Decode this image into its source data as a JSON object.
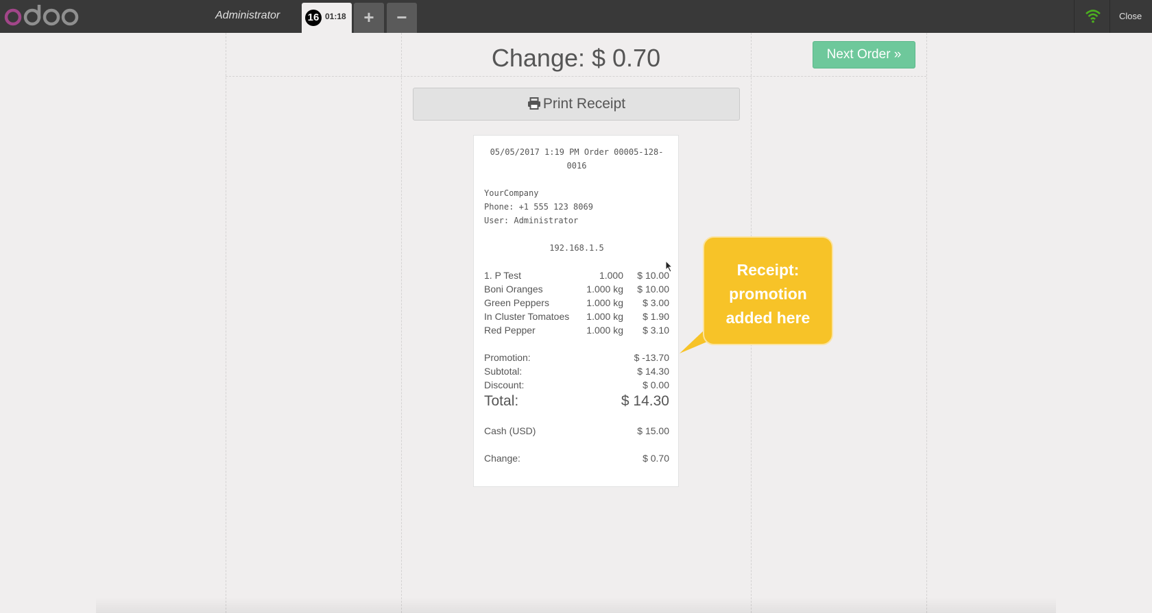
{
  "topbar": {
    "cashier": "Administrator",
    "order_tab": {
      "sequence": "16",
      "time": "01:18"
    },
    "add_order_icon": "plus-icon",
    "remove_order_icon": "minus-icon",
    "connection_icon": "wifi-icon",
    "connection_color": "#4caf1f",
    "close_label": "Close"
  },
  "screen": {
    "change_title": "Change: $ 0.70",
    "next_order_label": "Next Order »",
    "print_receipt_label": "Print Receipt",
    "print_icon": "printer-icon"
  },
  "receipt": {
    "header_line1": "05/05/2017 1:19 PM Order 00005-128-",
    "header_line2": "0016",
    "company": "YourCompany",
    "phone": "Phone: +1 555 123 8069",
    "user": "User: Administrator",
    "ip": "192.168.1.5",
    "lines": [
      {
        "name": "1. P Test",
        "qty": "1.000",
        "price": "$ 10.00"
      },
      {
        "name": "Boni Oranges",
        "qty": "1.000 kg",
        "price": "$ 10.00"
      },
      {
        "name": "Green Peppers",
        "qty": "1.000 kg",
        "price": "$ 3.00"
      },
      {
        "name": "In Cluster Tomatoes",
        "qty": "1.000 kg",
        "price": "$ 1.90"
      },
      {
        "name": "Red Pepper",
        "qty": "1.000 kg",
        "price": "$ 3.10"
      }
    ],
    "promotion": {
      "label": "Promotion:",
      "value": "$ -13.70"
    },
    "subtotal": {
      "label": "Subtotal:",
      "value": "$ 14.30"
    },
    "discount": {
      "label": "Discount:",
      "value": "$ 0.00"
    },
    "total": {
      "label": "Total:",
      "value": "$ 14.30"
    },
    "cash": {
      "label": "Cash (USD)",
      "value": "$ 15.00"
    },
    "change": {
      "label": "Change:",
      "value": "$ 0.70"
    }
  },
  "callout": {
    "line1": "Receipt:",
    "line2": "promotion",
    "line3": "added here",
    "color": "#f7c328"
  }
}
